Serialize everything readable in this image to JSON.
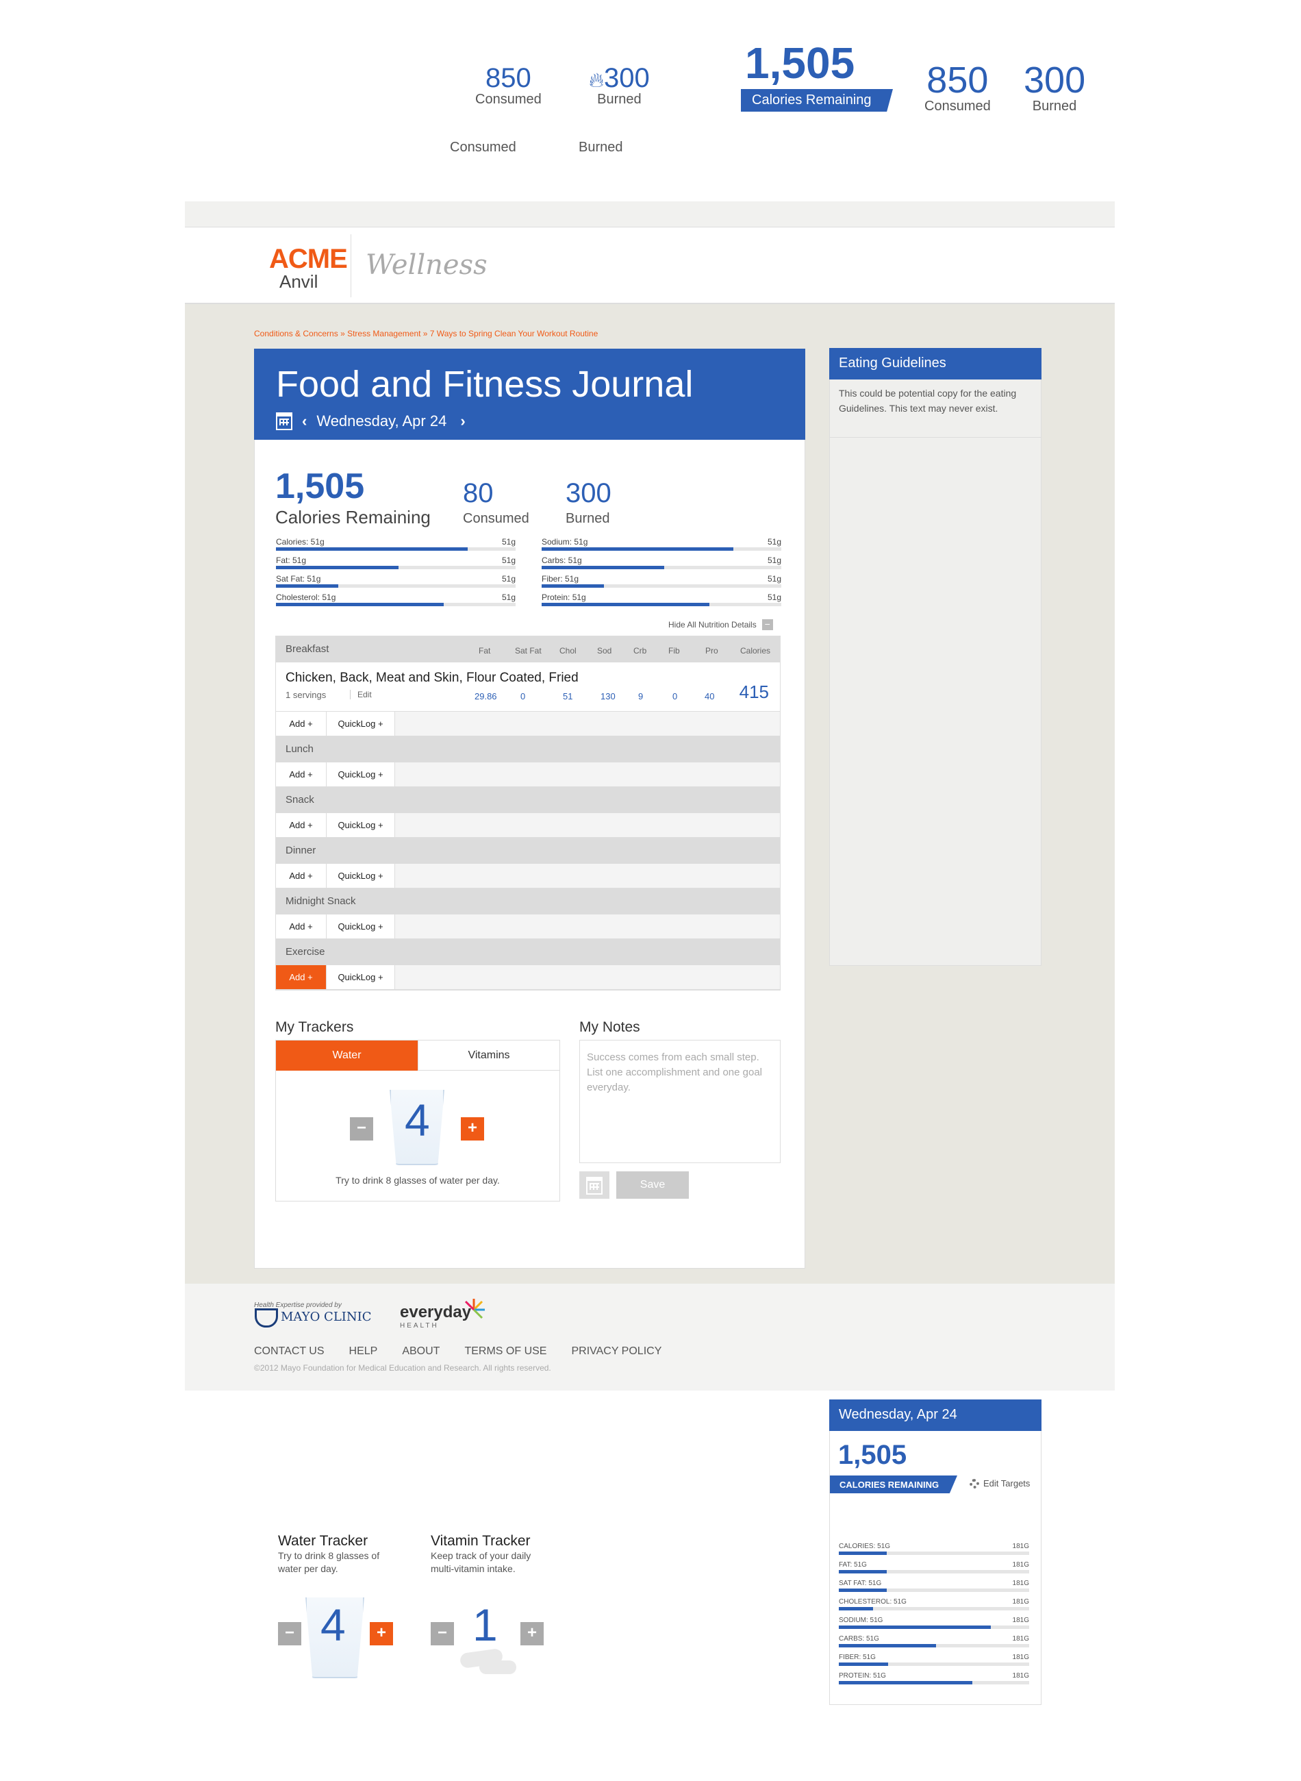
{
  "top_variant_a": {
    "consumed_value": "850",
    "consumed_label": "Consumed",
    "burned_value": "300",
    "burned_label": "Burned"
  },
  "top_variant_b": {
    "consumed_label": "Consumed",
    "burned_label": "Burned"
  },
  "top_variant_c": {
    "remaining_value": "1,505",
    "remaining_label": "Calories Remaining",
    "consumed_value": "850",
    "consumed_label": "Consumed",
    "burned_value": "300",
    "burned_label": "Burned"
  },
  "brand": {
    "acme": "ACME",
    "anvil": "Anvil",
    "wellness": "Wellness"
  },
  "breadcrumb": "Conditions & Concerns » Stress Management » 7 Ways to Spring Clean Your Workout Routine",
  "journal": {
    "title": "Food and Fitness Journal",
    "date": "Wednesday, Apr 24",
    "remaining_value": "1,505",
    "remaining_label": "Calories Remaining",
    "consumed_value": "80",
    "consumed_label": "Consumed",
    "burned_value": "300",
    "burned_label": "Burned",
    "bars_left": [
      {
        "label": "Calories: 51g",
        "value": "51g",
        "fill": 0.8
      },
      {
        "label": "Fat: 51g",
        "value": "51g",
        "fill": 0.51
      },
      {
        "label": "Sat Fat: 51g",
        "value": "51g",
        "fill": 0.26
      },
      {
        "label": "Cholesterol: 51g",
        "value": "51g",
        "fill": 0.7
      }
    ],
    "bars_right": [
      {
        "label": "Sodium: 51g",
        "value": "51g",
        "fill": 0.8
      },
      {
        "label": "Carbs: 51g",
        "value": "51g",
        "fill": 0.51
      },
      {
        "label": "Fiber: 51g",
        "value": "51g",
        "fill": 0.26
      },
      {
        "label": "Protein: 51g",
        "value": "51g",
        "fill": 0.7
      }
    ],
    "hide_details": "Hide All Nutrition Details",
    "columns": [
      "Fat",
      "Sat Fat",
      "Chol",
      "Sod",
      "Crb",
      "Fib",
      "Pro",
      "Calories"
    ],
    "meals": [
      {
        "name": "Breakfast"
      },
      {
        "name": "Lunch"
      },
      {
        "name": "Snack"
      },
      {
        "name": "Dinner"
      },
      {
        "name": "Midnight Snack"
      },
      {
        "name": "Exercise"
      }
    ],
    "food": {
      "name": "Chicken, Back, Meat and Skin, Flour Coated, Fried",
      "servings": "1 servings",
      "edit": "Edit",
      "values": [
        "29.86",
        "0",
        "51",
        "130",
        "9",
        "0",
        "40"
      ],
      "calories": "415"
    },
    "add_label": "Add +",
    "quicklog_label": "QuickLog +",
    "trackers_title": "My Trackers",
    "tab_water": "Water",
    "tab_vitamins": "Vitamins",
    "water_count": "4",
    "water_hint": "Try to drink 8 glasses of water per day.",
    "minus": "−",
    "plus": "+",
    "notes_title": "My Notes",
    "notes_placeholder": "Success comes from each small step. List one accomplishment and one goal everyday.",
    "save_label": "Save"
  },
  "guidelines": {
    "title": "Eating Guidelines",
    "copy": "This could be potential copy for the eating Guidelines. This text may never exist."
  },
  "footer": {
    "provided_by": "Health Expertise provided by",
    "mayo": "MAYO CLINIC",
    "everyday": "everyday",
    "everyday_sub": "HEALTH",
    "links": [
      "CONTACT US",
      "HELP",
      "ABOUT",
      "TERMS OF USE",
      "PRIVACY POLICY"
    ],
    "copyright": "©2012 Mayo Foundation for Medical Education and Research. All rights reserved."
  },
  "water_tracker": {
    "title": "Water Tracker",
    "desc": "Try to drink 8 glasses of water per day.",
    "count": "4"
  },
  "vitamin_tracker": {
    "title": "Vitamin Tracker",
    "desc": "Keep track of your daily multi-vitamin intake.",
    "count": "1"
  },
  "widget": {
    "date": "Wednesday, Apr 24",
    "remaining_value": "1,505",
    "remaining_label": "CALORIES REMAINING",
    "edit_targets": "Edit Targets",
    "bars": [
      {
        "label": "CALORIES: 51G",
        "value": "181G",
        "fill": 0.25
      },
      {
        "label": "FAT: 51G",
        "value": "181G",
        "fill": 0.25
      },
      {
        "label": "SAT FAT: 51G",
        "value": "181G",
        "fill": 0.25
      },
      {
        "label": "CHOLESTEROL: 51G",
        "value": "181G",
        "fill": 0.18
      },
      {
        "label": "SODIUM: 51G",
        "value": "181G",
        "fill": 0.8
      },
      {
        "label": "CARBS: 51G",
        "value": "181G",
        "fill": 0.51
      },
      {
        "label": "FIBER: 51G",
        "value": "181G",
        "fill": 0.26
      },
      {
        "label": "PROTEIN: 51G",
        "value": "181G",
        "fill": 0.7
      }
    ]
  },
  "colors": {
    "primary": "#2c5fb5",
    "accent": "#f05a16",
    "background": "#e8e7e0"
  }
}
